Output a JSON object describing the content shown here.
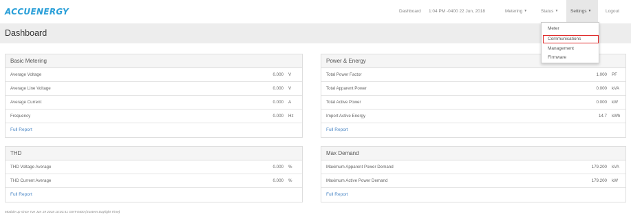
{
  "brand": {
    "logo": "ACCUENERGY"
  },
  "nav": {
    "dashboard": "Dashboard",
    "datetime": "1:04 PM -0400 22 Jun, 2018",
    "metering": "Metering",
    "status": "Status",
    "settings": "Settings",
    "logout": "Logout"
  },
  "settings_menu": {
    "items": [
      "Meter",
      "Communications",
      "Management",
      "Firmware"
    ],
    "highlighted": "Communications",
    "highlight_color": "#e02b2b"
  },
  "page": {
    "title": "Dashboard"
  },
  "panels": {
    "basic_metering": {
      "title": "Basic Metering",
      "rows": [
        {
          "label": "Average Voltage",
          "value": "0.000",
          "unit": "V"
        },
        {
          "label": "Average Line Voltage",
          "value": "0.000",
          "unit": "V"
        },
        {
          "label": "Average Current",
          "value": "0.000",
          "unit": "A"
        },
        {
          "label": "Frequency",
          "value": "0.000",
          "unit": "Hz"
        }
      ],
      "link": "Full Report"
    },
    "power_energy": {
      "title": "Power & Energy",
      "rows": [
        {
          "label": "Total Power Factor",
          "value": "1.000",
          "unit": "PF"
        },
        {
          "label": "Total Apparent Power",
          "value": "0.000",
          "unit": "kVA"
        },
        {
          "label": "Total Active Power",
          "value": "0.000",
          "unit": "kW"
        },
        {
          "label": "Import Active Energy",
          "value": "14.7",
          "unit": "kWh"
        }
      ],
      "link": "Full Report"
    },
    "thd": {
      "title": "THD",
      "rows": [
        {
          "label": "THD Voltage Average",
          "value": "0.000",
          "unit": "%"
        },
        {
          "label": "THD Current Average",
          "value": "0.000",
          "unit": "%"
        }
      ],
      "link": "Full Report"
    },
    "max_demand": {
      "title": "Max Demand",
      "rows": [
        {
          "label": "Maximum Apparent Power Demand",
          "value": "179.200",
          "unit": "kVA"
        },
        {
          "label": "Maximum Active Power Demand",
          "value": "179.200",
          "unit": "kW"
        }
      ],
      "link": "Full Report"
    }
  },
  "footer": {
    "uptime": "Module up since Tue Jun 19 2018 10:03:41 GMT-0400 (Eastern Daylight Time)"
  },
  "colors": {
    "accent": "#2a9fd8",
    "link": "#4a86c5"
  }
}
